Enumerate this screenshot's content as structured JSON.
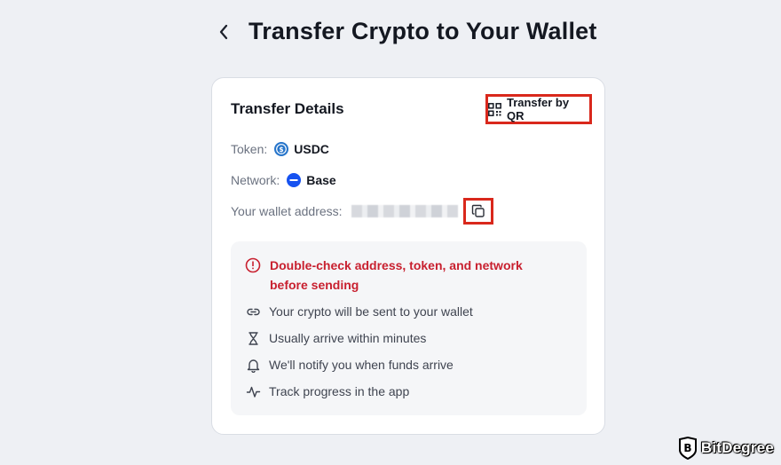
{
  "header": {
    "title": "Transfer Crypto to Your Wallet"
  },
  "card": {
    "title": "Transfer Details",
    "qr_button_label": "Transfer by QR",
    "token_label": "Token:",
    "token_value": "USDC",
    "network_label": "Network:",
    "network_value": "Base",
    "address_label": "Your wallet address:"
  },
  "info": {
    "warning": "Double-check address, token, and network before sending",
    "items": [
      {
        "icon": "link-icon",
        "text": "Your crypto will be sent to your wallet"
      },
      {
        "icon": "hourglass-icon",
        "text": "Usually arrive within minutes"
      },
      {
        "icon": "bell-icon",
        "text": "We'll notify you when funds arrive"
      },
      {
        "icon": "activity-icon",
        "text": "Track progress in the app"
      }
    ]
  },
  "brand": {
    "name": "BitDegree"
  },
  "colors": {
    "highlight": "#d9281c",
    "warning": "#c8202f",
    "usdc": "#2775ca",
    "base": "#1652f0"
  }
}
